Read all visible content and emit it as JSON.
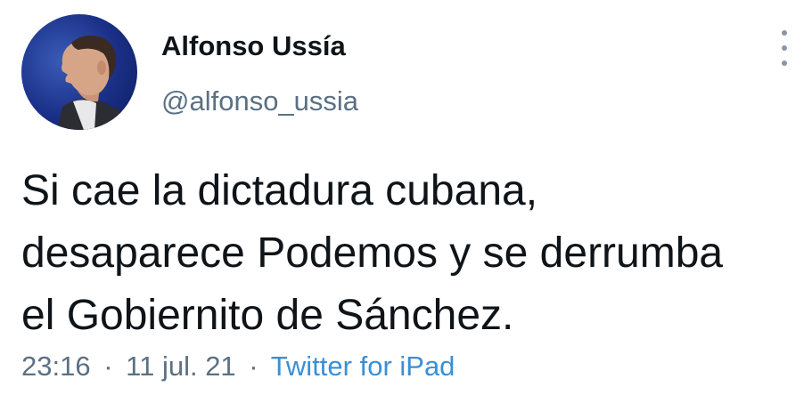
{
  "author": {
    "display_name": "Alfonso Ussía",
    "handle": "@alfonso_ussia",
    "avatar_icon": "profile-photo"
  },
  "tweet": {
    "text_lines": [
      "Si cae la dictadura cubana,",
      "desaparece Podemos y se derrumba",
      "el Gobiernito de Sánchez."
    ],
    "time": "23:16",
    "separator": "·",
    "date": "11 jul. 21",
    "source": "Twitter for iPad"
  },
  "menu": {
    "icon": "more-vertical-icon"
  },
  "colors": {
    "text": "#0f1419",
    "secondary": "#5b7083",
    "link": "#3a8fd6",
    "avatar_bg": "#1a2f86"
  }
}
